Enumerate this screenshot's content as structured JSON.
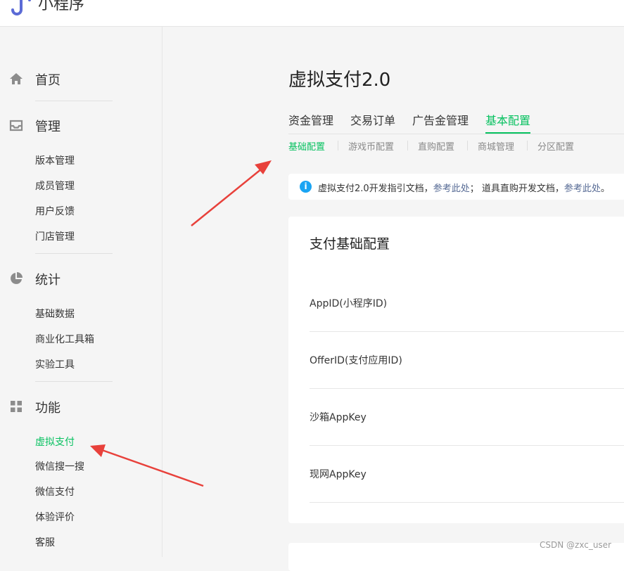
{
  "app": {
    "name": "小程序"
  },
  "sidebar": {
    "groups": [
      {
        "label": "首页",
        "icon": "home-icon",
        "items": []
      },
      {
        "label": "管理",
        "icon": "inbox-icon",
        "items": [
          "版本管理",
          "成员管理",
          "用户反馈",
          "门店管理"
        ]
      },
      {
        "label": "统计",
        "icon": "pie-chart-icon",
        "items": [
          "基础数据",
          "商业化工具箱",
          "实验工具"
        ]
      },
      {
        "label": "功能",
        "icon": "grid-icon",
        "items": [
          "虚拟支付",
          "微信搜一搜",
          "微信支付",
          "体验评价",
          "客服"
        ]
      }
    ],
    "active_item": "虚拟支付"
  },
  "main": {
    "title": "虚拟支付2.0",
    "tabs": [
      "资金管理",
      "交易订单",
      "广告金管理",
      "基本配置"
    ],
    "active_tab": "基本配置",
    "subtabs": [
      "基础配置",
      "游戏币配置",
      "直购配置",
      "商城管理",
      "分区配置"
    ],
    "active_subtab": "基础配置",
    "notice": {
      "text1": "虚拟支付2.0开发指引文档，",
      "link1": "参考此处",
      "text2": "； 道具直购开发文档，",
      "link2": "参考此处",
      "text3": "。"
    },
    "card": {
      "title": "支付基础配置",
      "fields": [
        "AppID(小程序ID)",
        "OfferID(支付应用ID)",
        "沙箱AppKey",
        "现网AppKey"
      ]
    }
  },
  "watermark": "CSDN @zxc_user",
  "colors": {
    "accent": "#07c160",
    "link": "#576b95",
    "info": "#1aa4f3",
    "arrow": "#e8413b"
  }
}
